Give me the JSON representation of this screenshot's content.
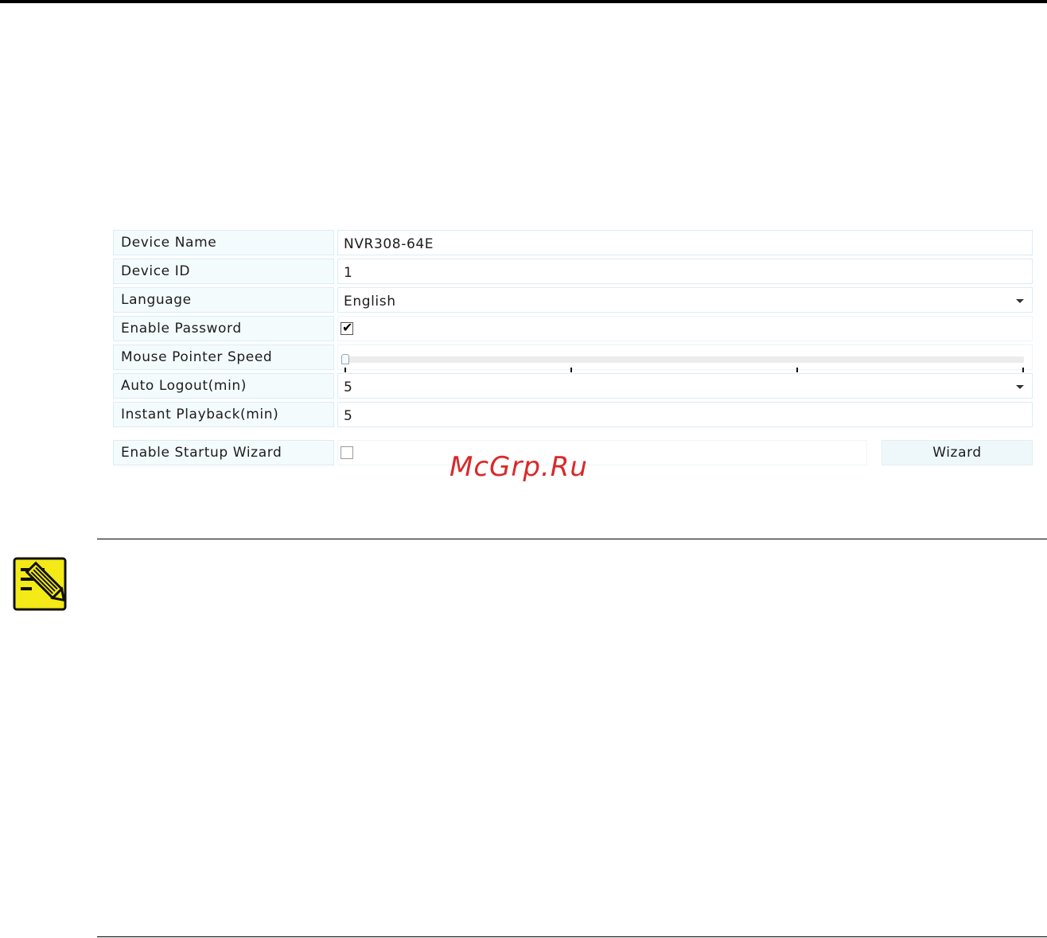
{
  "settings": {
    "device_name": {
      "label": "Device Name",
      "value": "NVR308-64E"
    },
    "device_id": {
      "label": "Device ID",
      "value": "1"
    },
    "language": {
      "label": "Language",
      "value": "English"
    },
    "enable_password": {
      "label": "Enable Password",
      "checked": true,
      "check_glyph": "✔"
    },
    "mouse_pointer_speed": {
      "label": "Mouse Pointer Speed",
      "level": 0
    },
    "auto_logout": {
      "label": "Auto Logout(min)",
      "value": "5"
    },
    "instant_playback": {
      "label": "Instant Playback(min)",
      "value": "5"
    },
    "startup_wizard": {
      "label": "Enable Startup Wizard",
      "checked": false,
      "button_label": "Wizard"
    }
  },
  "watermark": "McGrp.Ru",
  "colors": {
    "watermark": "#d9292a",
    "label_bg": "#f4fbfd",
    "border": "#dcecf2",
    "note_icon": "#f3ea17"
  },
  "icons": {
    "note": "note-pencil-icon",
    "dropdown": "chevron-down-icon"
  }
}
